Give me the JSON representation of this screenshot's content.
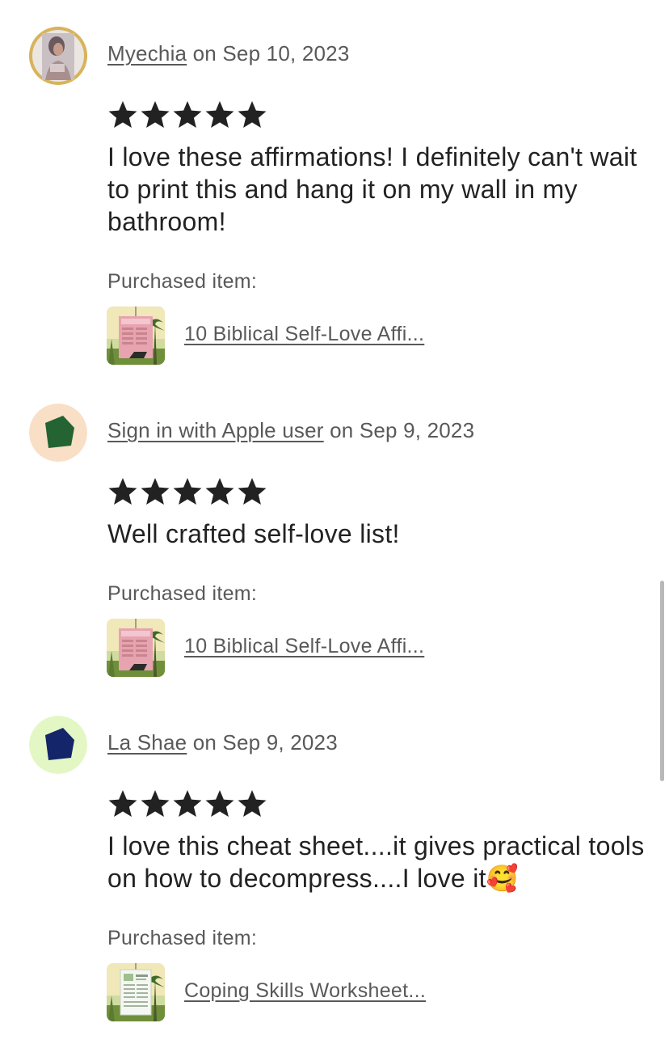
{
  "colors": {
    "star": "#222222",
    "meta_text": "#595959",
    "body_text": "#222222",
    "avatar2_bg": "#f8dfc6",
    "avatar2_shape": "#246332",
    "avatar3_bg": "#e3f7c4",
    "avatar3_shape": "#142569"
  },
  "reviews": [
    {
      "reviewer": "Myechia",
      "date_text": " on Sep 10, 2023",
      "rating": 5,
      "text": "I love these affirmations! I definitely can't wait to print this and hang it on my wall in my bathroom!",
      "purchased_label": "Purchased item:",
      "item_title": "10 Biblical Self-Love Affi...",
      "avatar_icon": "profile-photo",
      "thumb_icon": "affirmation-poster-thumbnail"
    },
    {
      "reviewer": "Sign in with Apple user",
      "date_text": " on Sep 9, 2023",
      "rating": 5,
      "text": "Well crafted self-love list!",
      "purchased_label": "Purchased item:",
      "item_title": "10 Biblical Self-Love Affi...",
      "avatar_icon": "pentagon-icon",
      "thumb_icon": "affirmation-poster-thumbnail"
    },
    {
      "reviewer": "La Shae",
      "date_text": " on Sep 9, 2023",
      "rating": 5,
      "text": "I love this cheat sheet....it gives practical tools on how to decompress....I love it",
      "emoji": "🥰",
      "purchased_label": "Purchased item:",
      "item_title": "Coping Skills Worksheet...",
      "avatar_icon": "pentagon-icon",
      "thumb_icon": "worksheet-thumbnail"
    }
  ]
}
